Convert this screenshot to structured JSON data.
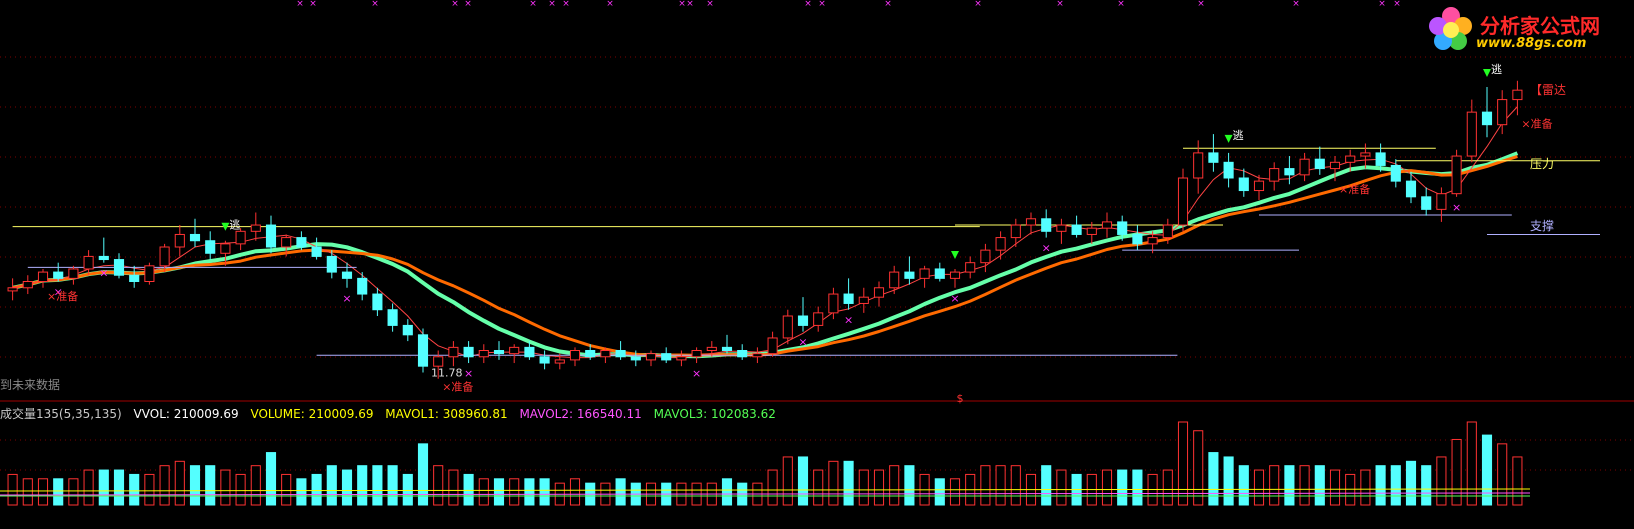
{
  "logo": {
    "name": "分析家公式网",
    "url": "www.88gs.com"
  },
  "price_panel": {
    "future_note": "到未来数据",
    "low_value_label": "11.78",
    "annotations": {
      "escape": "逃",
      "prepare": "准备",
      "radar": "【雷达",
      "pressure": "压力",
      "support": "支撑",
      "dollar": "$"
    }
  },
  "volume_panel": {
    "title": "成交量135(5,35,135)",
    "vvol": "VVOL: 210009.69",
    "volume": "VOLUME: 210009.69",
    "mavol1": "MAVOL1: 308960.81",
    "mavol2": "MAVOL2: 166540.11",
    "mavol3": "MAVOL3: 102083.62"
  },
  "colors": {
    "background": "#000000",
    "up_candle": "#ff3232",
    "down_candle": "#54ffff",
    "ma_slow": "#66ffaa",
    "ma_orange": "#ff6a00",
    "ma_thin": "#ff4444",
    "resistance": "#ffff66",
    "support": "#b0b0ff",
    "marker_magenta": "#ff33ff",
    "grid": "#800000",
    "mavol1": "#ffff00",
    "mavol2": "#ff55ff",
    "mavol3": "#55ff55"
  },
  "chart_data": {
    "type": "candlestick",
    "series": [
      {
        "name": "K",
        "ohlc": [
          [
            12.5,
            12.9,
            12.2,
            12.6
          ],
          [
            12.6,
            13.0,
            12.4,
            12.8
          ],
          [
            12.8,
            13.2,
            12.6,
            13.1
          ],
          [
            13.1,
            13.4,
            12.8,
            12.9
          ],
          [
            12.9,
            13.3,
            12.7,
            13.2
          ],
          [
            13.2,
            13.8,
            13.0,
            13.6
          ],
          [
            13.6,
            14.2,
            13.4,
            13.5
          ],
          [
            13.5,
            13.7,
            12.9,
            13.0
          ],
          [
            13.0,
            13.3,
            12.6,
            12.8
          ],
          [
            12.8,
            13.4,
            12.7,
            13.3
          ],
          [
            13.3,
            14.0,
            13.1,
            13.9
          ],
          [
            13.9,
            14.6,
            13.6,
            14.3
          ],
          [
            14.3,
            14.8,
            13.9,
            14.1
          ],
          [
            14.1,
            14.4,
            13.5,
            13.7
          ],
          [
            13.7,
            14.1,
            13.3,
            14.0
          ],
          [
            14.0,
            14.5,
            13.8,
            14.4
          ],
          [
            14.4,
            15.0,
            14.1,
            14.6
          ],
          [
            14.6,
            14.9,
            13.7,
            13.9
          ],
          [
            13.9,
            14.3,
            13.6,
            14.2
          ],
          [
            14.2,
            14.4,
            13.8,
            13.9
          ],
          [
            13.9,
            14.2,
            13.5,
            13.6
          ],
          [
            13.6,
            13.8,
            12.9,
            13.1
          ],
          [
            13.1,
            13.4,
            12.6,
            12.9
          ],
          [
            12.9,
            13.1,
            12.2,
            12.4
          ],
          [
            12.4,
            12.6,
            11.7,
            11.9
          ],
          [
            11.9,
            12.1,
            11.2,
            11.4
          ],
          [
            11.4,
            11.6,
            10.9,
            11.1
          ],
          [
            11.1,
            11.3,
            9.9,
            10.1
          ],
          [
            10.1,
            10.6,
            9.7,
            10.4
          ],
          [
            10.4,
            10.9,
            10.1,
            10.7
          ],
          [
            10.7,
            10.9,
            10.2,
            10.4
          ],
          [
            10.4,
            10.8,
            10.2,
            10.6
          ],
          [
            10.6,
            10.9,
            10.3,
            10.5
          ],
          [
            10.5,
            10.8,
            10.2,
            10.7
          ],
          [
            10.7,
            10.9,
            10.3,
            10.4
          ],
          [
            10.4,
            10.6,
            10.0,
            10.2
          ],
          [
            10.2,
            10.5,
            10.0,
            10.3
          ],
          [
            10.3,
            10.7,
            10.1,
            10.6
          ],
          [
            10.6,
            10.8,
            10.3,
            10.4
          ],
          [
            10.4,
            10.7,
            10.2,
            10.6
          ],
          [
            10.6,
            10.9,
            10.3,
            10.4
          ],
          [
            10.4,
            10.6,
            10.1,
            10.3
          ],
          [
            10.3,
            10.6,
            10.1,
            10.5
          ],
          [
            10.5,
            10.7,
            10.2,
            10.3
          ],
          [
            10.3,
            10.6,
            10.1,
            10.4
          ],
          [
            10.4,
            10.7,
            10.2,
            10.6
          ],
          [
            10.6,
            10.9,
            10.4,
            10.7
          ],
          [
            10.7,
            11.1,
            10.5,
            10.6
          ],
          [
            10.6,
            10.8,
            10.3,
            10.4
          ],
          [
            10.4,
            10.7,
            10.2,
            10.5
          ],
          [
            10.5,
            11.2,
            10.4,
            11.0
          ],
          [
            11.0,
            11.9,
            10.8,
            11.7
          ],
          [
            11.7,
            12.3,
            11.2,
            11.4
          ],
          [
            11.4,
            12.0,
            11.2,
            11.8
          ],
          [
            11.8,
            12.6,
            11.6,
            12.4
          ],
          [
            12.4,
            12.9,
            11.9,
            12.1
          ],
          [
            12.1,
            12.6,
            11.8,
            12.3
          ],
          [
            12.3,
            12.8,
            12.0,
            12.6
          ],
          [
            12.6,
            13.3,
            12.4,
            13.1
          ],
          [
            13.1,
            13.6,
            12.7,
            12.9
          ],
          [
            12.9,
            13.3,
            12.6,
            13.2
          ],
          [
            13.2,
            13.4,
            12.8,
            12.9
          ],
          [
            12.9,
            13.2,
            12.6,
            13.1
          ],
          [
            13.1,
            13.6,
            12.9,
            13.4
          ],
          [
            13.4,
            14.0,
            13.1,
            13.8
          ],
          [
            13.8,
            14.4,
            13.5,
            14.2
          ],
          [
            14.2,
            14.8,
            13.9,
            14.6
          ],
          [
            14.6,
            15.0,
            14.3,
            14.8
          ],
          [
            14.8,
            15.1,
            14.2,
            14.4
          ],
          [
            14.4,
            14.8,
            14.0,
            14.6
          ],
          [
            14.6,
            14.9,
            14.2,
            14.3
          ],
          [
            14.3,
            14.7,
            14.0,
            14.5
          ],
          [
            14.5,
            15.0,
            14.2,
            14.7
          ],
          [
            14.7,
            14.9,
            14.1,
            14.3
          ],
          [
            14.3,
            14.6,
            13.8,
            14.0
          ],
          [
            14.0,
            14.4,
            13.7,
            14.2
          ],
          [
            14.2,
            14.8,
            14.0,
            14.6
          ],
          [
            14.6,
            16.4,
            14.4,
            16.1
          ],
          [
            16.1,
            17.3,
            15.6,
            16.9
          ],
          [
            16.9,
            17.5,
            16.3,
            16.6
          ],
          [
            16.6,
            16.9,
            15.8,
            16.1
          ],
          [
            16.1,
            16.4,
            15.5,
            15.7
          ],
          [
            15.7,
            16.2,
            15.4,
            16.0
          ],
          [
            16.0,
            16.6,
            15.7,
            16.4
          ],
          [
            16.4,
            16.8,
            15.9,
            16.2
          ],
          [
            16.2,
            16.9,
            16.0,
            16.7
          ],
          [
            16.7,
            17.1,
            16.2,
            16.4
          ],
          [
            16.4,
            16.8,
            16.0,
            16.6
          ],
          [
            16.6,
            17.0,
            16.3,
            16.8
          ],
          [
            16.8,
            17.2,
            16.4,
            16.9
          ],
          [
            16.9,
            17.2,
            16.3,
            16.5
          ],
          [
            16.5,
            16.7,
            15.8,
            16.0
          ],
          [
            16.0,
            16.3,
            15.3,
            15.5
          ],
          [
            15.5,
            15.8,
            14.9,
            15.1
          ],
          [
            15.1,
            15.8,
            14.7,
            15.6
          ],
          [
            15.6,
            17.0,
            15.5,
            16.8
          ],
          [
            16.8,
            18.6,
            16.6,
            18.2
          ],
          [
            18.2,
            19.0,
            17.4,
            17.8
          ],
          [
            17.8,
            18.9,
            17.5,
            18.6
          ],
          [
            18.6,
            19.2,
            18.1,
            18.9
          ]
        ]
      }
    ],
    "moving_averages": [
      "MA slow (green/orange)",
      "MA fast (thin red)"
    ],
    "ylim": [
      9.5,
      20.5
    ]
  }
}
